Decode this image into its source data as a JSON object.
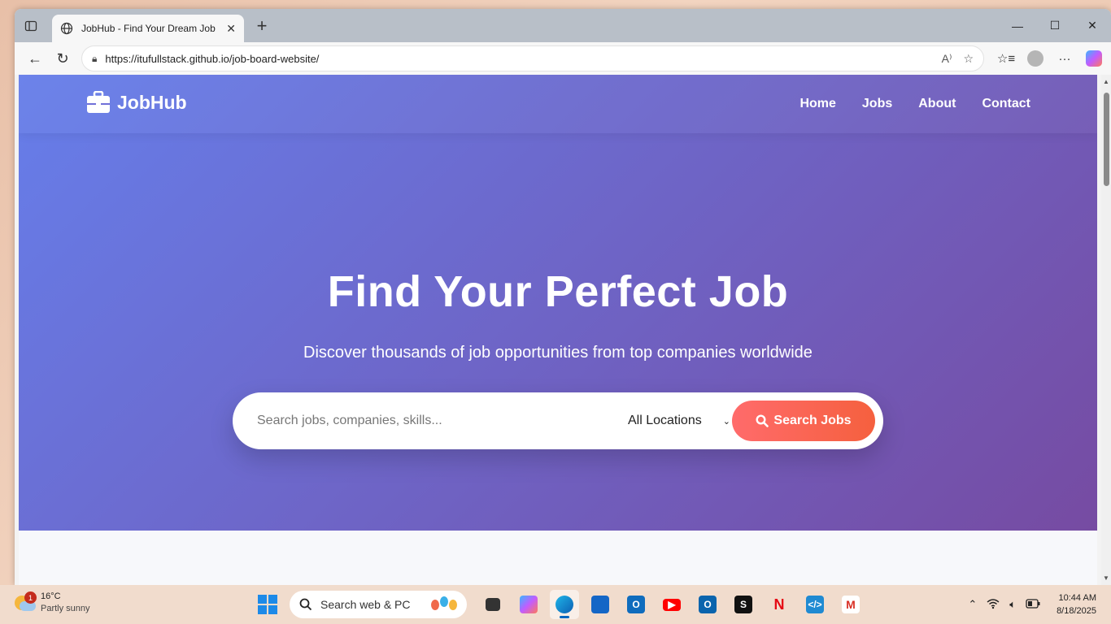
{
  "browser": {
    "tab_title": "JobHub - Find Your Dream Job",
    "url": "https://itufullstack.github.io/job-board-website/"
  },
  "site": {
    "brand": "JobHub",
    "nav": [
      "Home",
      "Jobs",
      "About",
      "Contact"
    ]
  },
  "hero": {
    "title": "Find Your Perfect Job",
    "subtitle": "Discover thousands of job opportunities from top companies worldwide",
    "search_placeholder": "Search jobs, companies, skills...",
    "location_selected": "All Locations",
    "search_button": "Search Jobs"
  },
  "taskbar": {
    "weather_temp": "16°C",
    "weather_desc": "Partly sunny",
    "weather_badge": "1",
    "search_placeholder": "Search web & PC",
    "time": "10:44 AM",
    "date": "8/18/2025"
  },
  "colors": {
    "hero_start": "#667eea",
    "hero_end": "#764ba2",
    "button_start": "#ff6b6b",
    "button_end": "#f5603e"
  }
}
